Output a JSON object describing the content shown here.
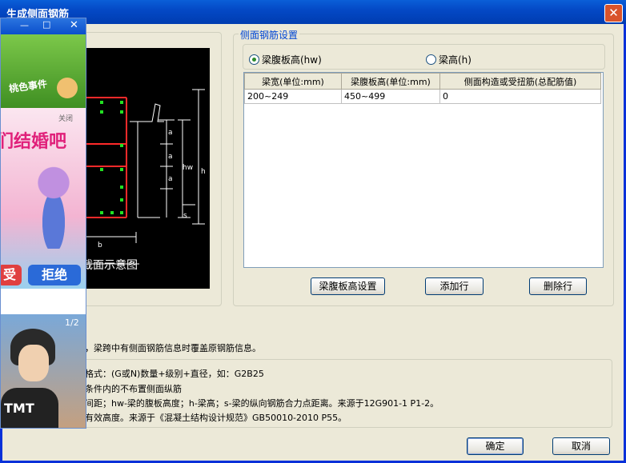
{
  "window": {
    "title": "生成侧面钢筋",
    "close_glyph": "✕"
  },
  "settings_group": {
    "title": "侧面钢筋设置",
    "radio_web_height": "梁腹板高(hw)",
    "radio_beam_height": "梁高(h)",
    "selected": "梁腹板高(hw)"
  },
  "table": {
    "headers": [
      "梁宽(单位:mm)",
      "梁腹板高(单位:mm)",
      "侧面构造或受扭筋(总配筋值)"
    ],
    "rows": [
      [
        "200~249",
        "450~499",
        "0"
      ]
    ]
  },
  "buttons": {
    "web_height_settings": "梁腹板高设置",
    "add_row": "添加行",
    "delete_row": "删除行",
    "ok": "确定",
    "cancel": "取消"
  },
  "diagram": {
    "caption": "截面示意图",
    "labels": {
      "a": "a",
      "hw": "hw",
      "h": "h",
      "s": "s",
      "b": "b"
    }
  },
  "notes": {
    "line1": "，梁跨中有侧面钢筋信息时覆盖原钢筋信息。",
    "line2": "格式：(G或N)数量+级别+直径，如：G2B25",
    "line3": "条件内的不布置侧面纵筋",
    "line4": "间距；hw-梁的腹板高度；h-梁高；s-梁的纵向钢筋合力点距离。来源于12G901-1 P1-2。",
    "line5": "有效高度。来源于《混凝土结构设计规范》GB50010-2010 P55。"
  },
  "ad_popup": {
    "banner_text": "桃色事件",
    "headline": "们结婚吧",
    "accept_label": "受",
    "reject_label": "拒绝",
    "close_hint": "关闭",
    "page_indicator": "1/2",
    "shirt_text": "TMT"
  }
}
